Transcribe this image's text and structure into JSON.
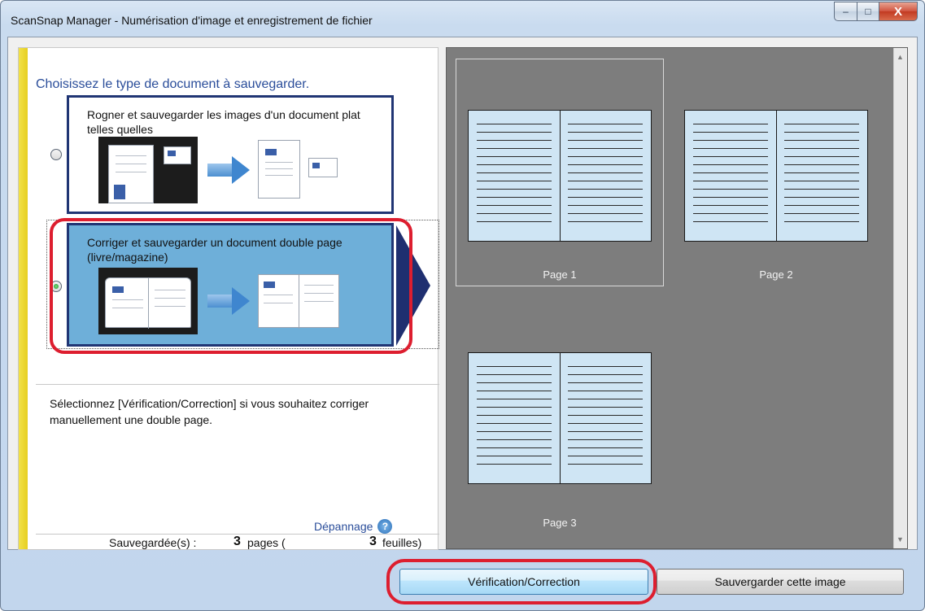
{
  "window": {
    "title": "ScanSnap Manager - Numérisation d'image et enregistrement de fichier",
    "controls": {
      "minimize": "–",
      "maximize": "□",
      "close": "X"
    }
  },
  "panel": {
    "heading": "Choisissez le type de document à sauvegarder.",
    "options": [
      {
        "label": "Rogner et sauvegarder les images d'un document plat telles quelles",
        "selected": false
      },
      {
        "label": "Corriger et sauvegarder un document double page (livre/magazine)",
        "selected": true
      }
    ],
    "hint": "Sélectionnez [Vérification/Correction] si vous souhaitez corriger manuellement une double page.",
    "troubleshoot": "Dépannage",
    "help_symbol": "?",
    "status": {
      "saved_label": "Sauvegardée(s) :",
      "pages_count": "3",
      "pages_text": "pages (",
      "sheets_count": "3",
      "sheets_text": "feuilles)"
    }
  },
  "preview": {
    "pages": [
      {
        "label": "Page 1",
        "selected": true
      },
      {
        "label": "Page 2",
        "selected": false
      },
      {
        "label": "Page 3",
        "selected": false
      }
    ],
    "scroll_up": "▲",
    "scroll_down": "▼"
  },
  "buttons": {
    "check_correct": "Vérification/Correction",
    "save_image": "Sauvergarder cette image"
  },
  "colors": {
    "accent_blue": "#2a4d9a",
    "selected_option_bg": "#6eafd9",
    "highlight_red": "#dd1e2f"
  }
}
